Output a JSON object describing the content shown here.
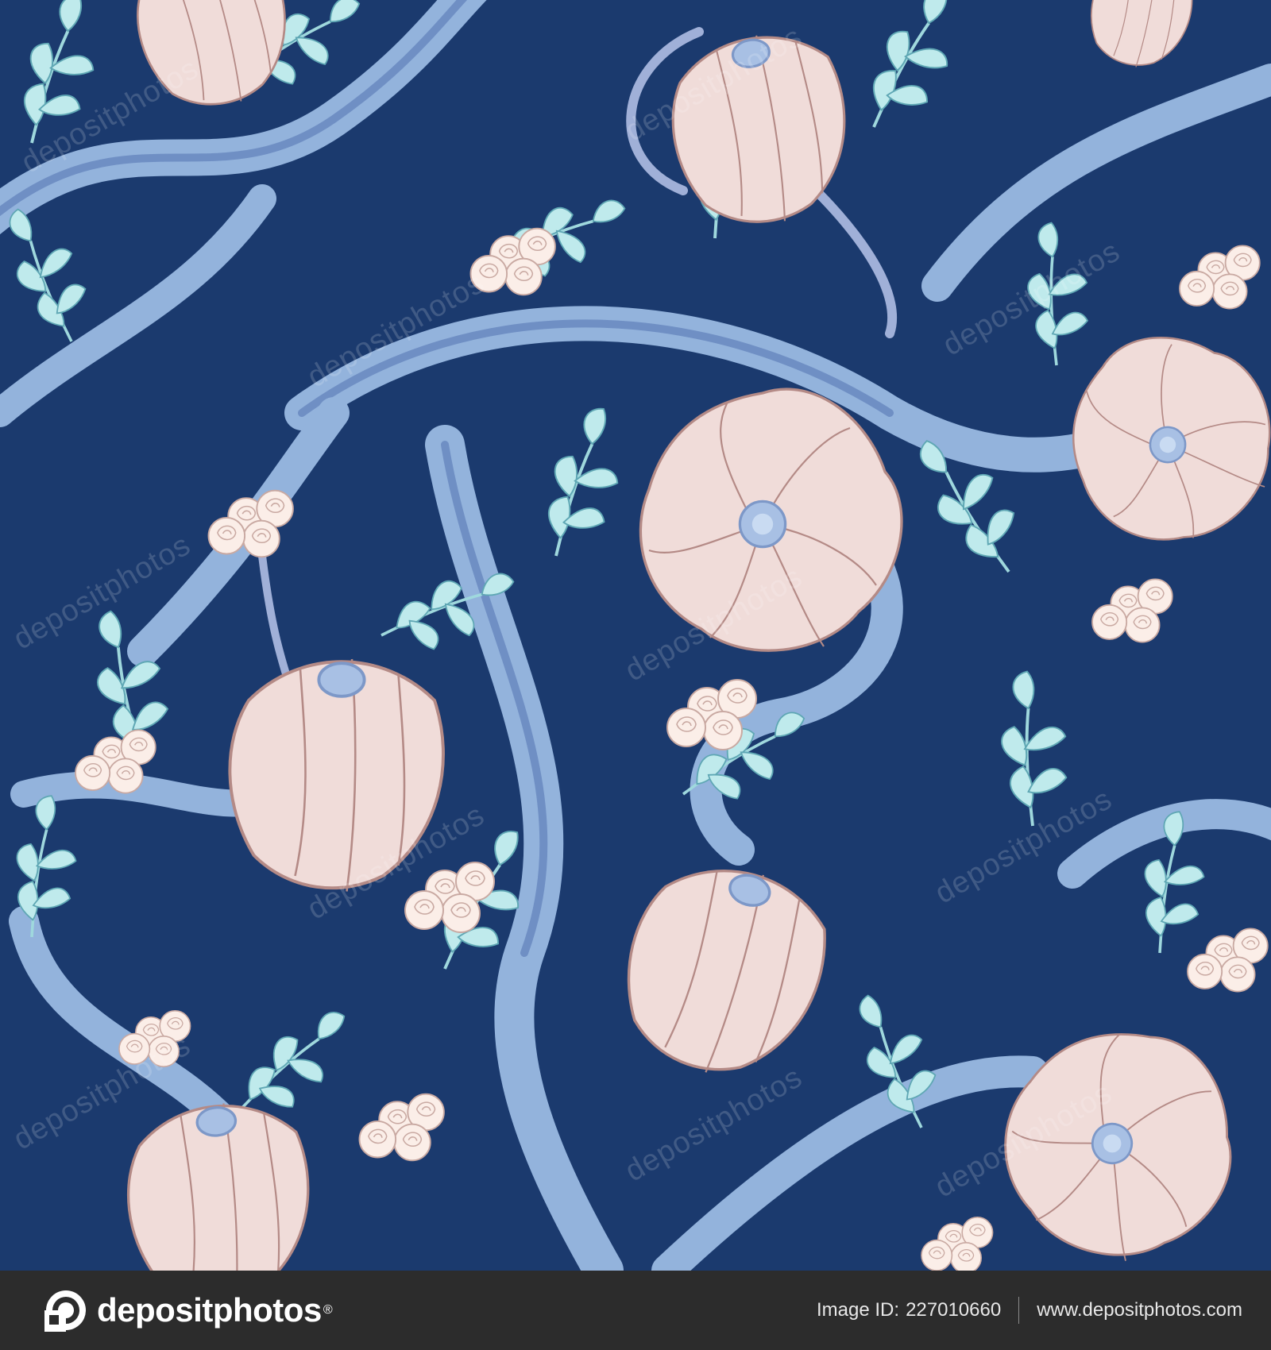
{
  "watermark": {
    "text": "depositphotos"
  },
  "footer": {
    "brand": "depositphotos",
    "image_id_label": "Image ID:",
    "image_id": "227010660",
    "website": "www.depositphotos.com"
  },
  "colors": {
    "background": "#1b3a6e",
    "stem_blue": "#93b3dc",
    "stem_shadow": "#6f8fc4",
    "leaf_mint": "#bfeaec",
    "leaf_vein": "#5fa7b4",
    "flower_pink": "#f0dcd9",
    "flower_outline": "#b48a86",
    "rose_cream": "#fbeee8",
    "footer_bg": "#2c2c2c"
  },
  "icons": {
    "logo": "depositphotos-logo-icon"
  }
}
